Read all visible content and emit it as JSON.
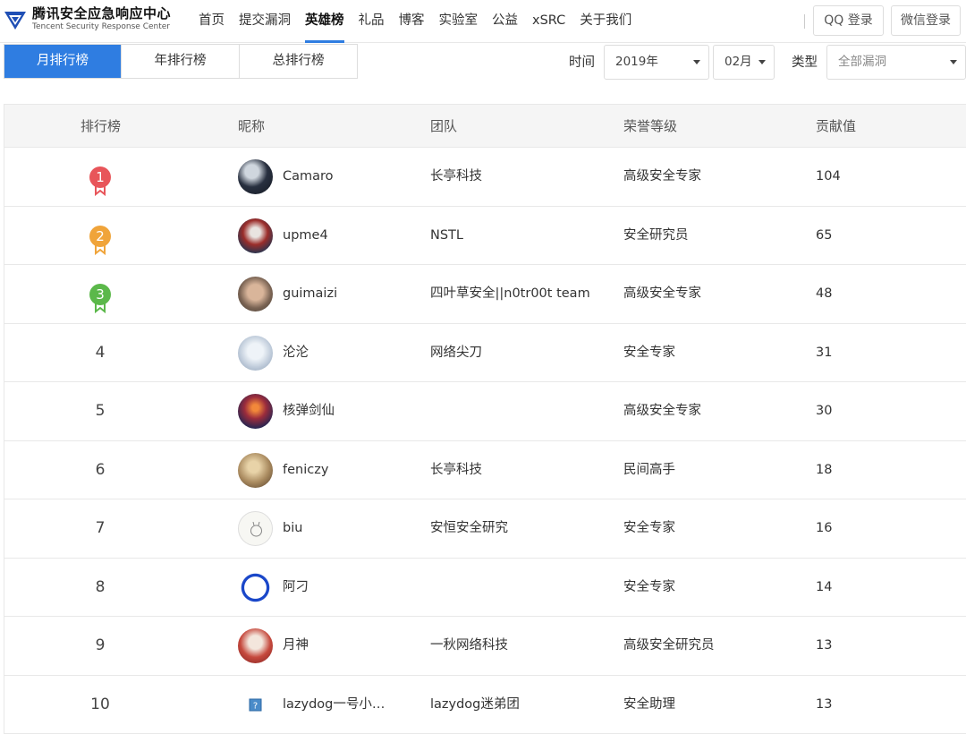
{
  "header": {
    "logo_title": "腾讯安全应急响应中心",
    "logo_subtitle": "Tencent Security Response Center",
    "nav": [
      "首页",
      "提交漏洞",
      "英雄榜",
      "礼品",
      "博客",
      "实验室",
      "公益",
      "xSRC",
      "关于我们"
    ],
    "active_nav": "英雄榜",
    "qq_login": "QQ 登录",
    "wechat_login": "微信登录"
  },
  "tabs": [
    "月排行榜",
    "年排行榜",
    "总排行榜"
  ],
  "active_tab": "月排行榜",
  "filters": {
    "time_label": "时间",
    "year": "2019年",
    "month": "02月",
    "type_label": "类型",
    "type": "全部漏洞"
  },
  "table": {
    "headers": [
      "排行榜",
      "昵称",
      "团队",
      "荣誉等级",
      "贡献值"
    ],
    "rows": [
      {
        "rank": "1",
        "nickname": "Camaro",
        "team": "长亭科技",
        "level": "高级安全专家",
        "score": "104"
      },
      {
        "rank": "2",
        "nickname": "upme4",
        "team": "NSTL",
        "level": "安全研究员",
        "score": "65"
      },
      {
        "rank": "3",
        "nickname": "guimaizi",
        "team": "四叶草安全||n0tr00t team",
        "level": "高级安全专家",
        "score": "48"
      },
      {
        "rank": "4",
        "nickname": "沦沦",
        "team": "网络尖刀",
        "level": "安全专家",
        "score": "31"
      },
      {
        "rank": "5",
        "nickname": "核弹剑仙",
        "team": "",
        "level": "高级安全专家",
        "score": "30"
      },
      {
        "rank": "6",
        "nickname": "feniczy",
        "team": "长亭科技",
        "level": "民间高手",
        "score": "18"
      },
      {
        "rank": "7",
        "nickname": "biu",
        "team": "安恒安全研究",
        "level": "安全专家",
        "score": "16"
      },
      {
        "rank": "8",
        "nickname": "阿刁",
        "team": "",
        "level": "安全专家",
        "score": "14"
      },
      {
        "rank": "9",
        "nickname": "月神",
        "team": "一秋网络科技",
        "level": "高级安全研究员",
        "score": "13"
      },
      {
        "rank": "10",
        "nickname": "lazydog一号小…",
        "team": "lazydog迷弟团",
        "level": "安全助理",
        "score": "13"
      }
    ]
  },
  "colors": {
    "accent": "#2f7de1",
    "medal_1": "#e8555a",
    "medal_2": "#f0a43a",
    "medal_3": "#5bb84a"
  },
  "icons": {
    "logo": "tencent-triangle-logo",
    "select_caret": "caret-down-icon",
    "medal": "ribbon-medal-icon"
  }
}
